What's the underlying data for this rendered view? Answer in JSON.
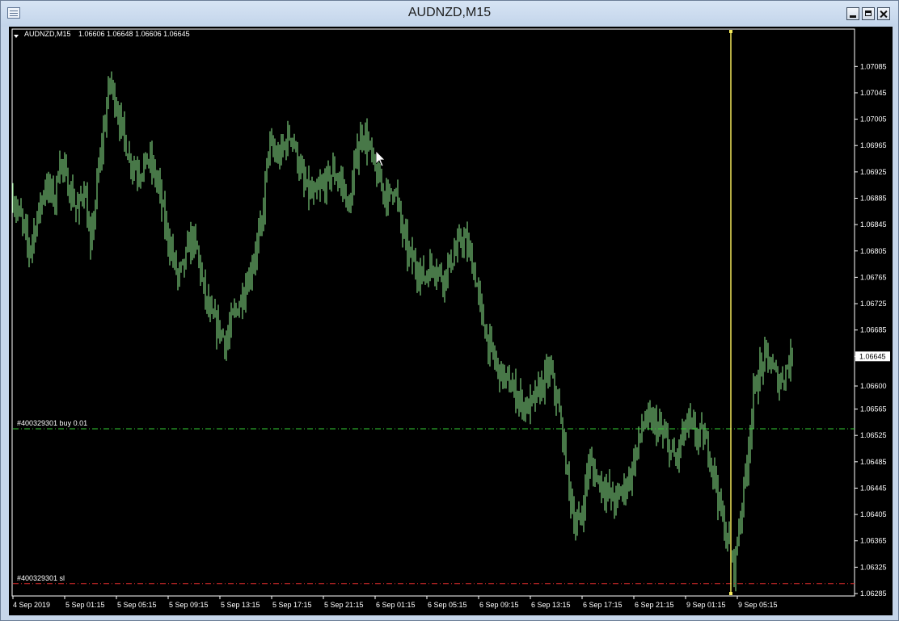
{
  "window": {
    "title": "AUDNZD,M15",
    "buttons": {
      "minimize": "minimize",
      "maximize": "maximize",
      "close": "close"
    }
  },
  "chart": {
    "header_symbol": "AUDNZD,M15",
    "header_ohlc": "1.06606 1.06648 1.06606 1.06645",
    "orders": [
      {
        "label": "#400329301 buy 0.01",
        "price": 1.06535,
        "color": "#33cc33"
      },
      {
        "label": "#400329301 sl",
        "price": 1.063,
        "color": "#d92b2b"
      }
    ],
    "current_price_label": "1.06645",
    "current_price": 1.06645,
    "vertical_line_color": "#f2e85c",
    "candle_color": "#8ff08f",
    "background": "#000000"
  },
  "chart_data": {
    "type": "candlestick",
    "timeframe": "M15",
    "ylim": [
      1.06285,
      1.07105
    ],
    "y_ticks": [
      "1.07085",
      "1.07045",
      "1.07005",
      "1.06965",
      "1.06925",
      "1.06885",
      "1.06845",
      "1.06805",
      "1.06765",
      "1.06725",
      "1.06685",
      "1.06645",
      "1.06600",
      "1.06565",
      "1.06525",
      "1.06485",
      "1.06445",
      "1.06405",
      "1.06365",
      "1.06325",
      "1.06285"
    ],
    "x_ticks": [
      "4 Sep 2019",
      "5 Sep 01:15",
      "5 Sep 05:15",
      "5 Sep 09:15",
      "5 Sep 13:15",
      "5 Sep 17:15",
      "5 Sep 21:15",
      "6 Sep 01:15",
      "6 Sep 05:15",
      "6 Sep 09:15",
      "6 Sep 13:15",
      "6 Sep 17:15",
      "6 Sep 21:15",
      "9 Sep 01:15",
      "9 Sep 05:15"
    ],
    "close_path": [
      [
        0,
        1.06885
      ],
      [
        6,
        1.06845
      ],
      [
        10,
        1.06805
      ],
      [
        16,
        1.06865
      ],
      [
        20,
        1.06905
      ],
      [
        26,
        1.06885
      ],
      [
        29,
        1.06945
      ],
      [
        34,
        1.06905
      ],
      [
        40,
        1.06865
      ],
      [
        44,
        1.06905
      ],
      [
        48,
        1.06805
      ],
      [
        52,
        1.06905
      ],
      [
        56,
        1.06985
      ],
      [
        60,
        1.07065
      ],
      [
        64,
        1.07025
      ],
      [
        68,
        1.06985
      ],
      [
        72,
        1.06945
      ],
      [
        78,
        1.06925
      ],
      [
        84,
        1.06945
      ],
      [
        90,
        1.06905
      ],
      [
        94,
        1.06845
      ],
      [
        98,
        1.06805
      ],
      [
        102,
        1.06765
      ],
      [
        106,
        1.06785
      ],
      [
        110,
        1.06825
      ],
      [
        114,
        1.06805
      ],
      [
        118,
        1.06745
      ],
      [
        122,
        1.06705
      ],
      [
        128,
        1.06685
      ],
      [
        132,
        1.06665
      ],
      [
        136,
        1.06705
      ],
      [
        140,
        1.06725
      ],
      [
        146,
        1.06765
      ],
      [
        150,
        1.06805
      ],
      [
        154,
        1.06845
      ],
      [
        158,
        1.06965
      ],
      [
        164,
        1.06945
      ],
      [
        168,
        1.06965
      ],
      [
        172,
        1.06985
      ],
      [
        176,
        1.06945
      ],
      [
        180,
        1.06905
      ],
      [
        186,
        1.06885
      ],
      [
        192,
        1.06905
      ],
      [
        198,
        1.06925
      ],
      [
        204,
        1.06905
      ],
      [
        208,
        1.06865
      ],
      [
        212,
        1.06945
      ],
      [
        216,
        1.06985
      ],
      [
        220,
        1.06965
      ],
      [
        224,
        1.06925
      ],
      [
        228,
        1.06905
      ],
      [
        232,
        1.06885
      ],
      [
        236,
        1.06905
      ],
      [
        240,
        1.06845
      ],
      [
        244,
        1.06805
      ],
      [
        248,
        1.06785
      ],
      [
        254,
        1.06765
      ],
      [
        260,
        1.06785
      ],
      [
        266,
        1.06765
      ],
      [
        270,
        1.06785
      ],
      [
        274,
        1.06805
      ],
      [
        278,
        1.06825
      ],
      [
        282,
        1.06805
      ],
      [
        286,
        1.06765
      ],
      [
        290,
        1.06705
      ],
      [
        294,
        1.06665
      ],
      [
        300,
        1.06625
      ],
      [
        306,
        1.06605
      ],
      [
        312,
        1.06585
      ],
      [
        318,
        1.06565
      ],
      [
        324,
        1.06585
      ],
      [
        328,
        1.06605
      ],
      [
        332,
        1.06625
      ],
      [
        336,
        1.06585
      ],
      [
        340,
        1.06525
      ],
      [
        344,
        1.06445
      ],
      [
        348,
        1.06385
      ],
      [
        352,
        1.06405
      ],
      [
        356,
        1.06485
      ],
      [
        360,
        1.06465
      ],
      [
        366,
        1.06445
      ],
      [
        372,
        1.06425
      ],
      [
        378,
        1.06445
      ],
      [
        382,
        1.06465
      ],
      [
        386,
        1.06505
      ],
      [
        390,
        1.06545
      ],
      [
        396,
        1.06545
      ],
      [
        402,
        1.06525
      ],
      [
        406,
        1.06505
      ],
      [
        410,
        1.06485
      ],
      [
        414,
        1.06525
      ],
      [
        418,
        1.06545
      ],
      [
        422,
        1.06525
      ],
      [
        426,
        1.06525
      ],
      [
        430,
        1.06505
      ],
      [
        434,
        1.06465
      ],
      [
        438,
        1.06405
      ],
      [
        442,
        1.06365
      ],
      [
        446,
        1.06325
      ],
      [
        450,
        1.06405
      ],
      [
        454,
        1.06485
      ],
      [
        458,
        1.06585
      ],
      [
        462,
        1.06625
      ],
      [
        466,
        1.06645
      ],
      [
        470,
        1.06625
      ],
      [
        474,
        1.06605
      ],
      [
        478,
        1.06625
      ],
      [
        482,
        1.06645
      ]
    ]
  }
}
